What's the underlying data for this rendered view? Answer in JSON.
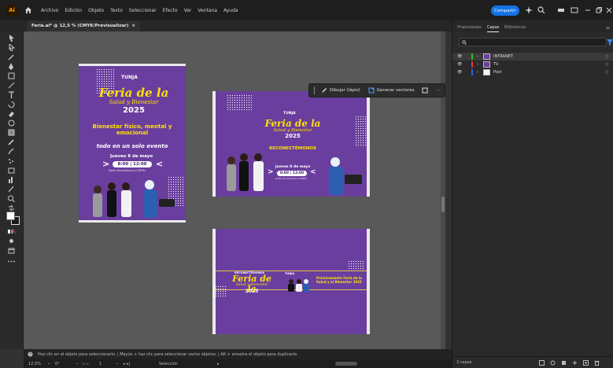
{
  "menu": {
    "app_badge": "Ai",
    "items": [
      "Archivo",
      "Edición",
      "Objeto",
      "Texto",
      "Seleccionar",
      "Efecto",
      "Ver",
      "Ventana",
      "Ayuda"
    ],
    "share_label": "Compartir"
  },
  "document_tab": {
    "title": "Feria.ai* @ 12,5 % (CMYK/Previsualizar)",
    "close": "×"
  },
  "context_bar": {
    "draw_label": "Dibujar (lápiz)",
    "vectorize_label": "Generar vectores",
    "more": "···"
  },
  "panel": {
    "tabs": [
      "Propiedades",
      "Capas",
      "Bibliotecas"
    ],
    "active_tab": "Capas",
    "layers": [
      {
        "name": "INTRANET",
        "color": "#2dbe2d",
        "selected": true
      },
      {
        "name": "TV",
        "color": "#e03a3a",
        "selected": false
      },
      {
        "name": "Post",
        "color": "#3a5ae0",
        "selected": false
      }
    ],
    "layer_count": "3 capas"
  },
  "artboards": {
    "brand": "TUNJA",
    "title_line1": "Feria de la",
    "title_line2": "Salud y Bienestar",
    "year": "2025",
    "tagline1": "Bienestar físico, mental y emocional",
    "tagline2": "todo en un solo evento",
    "date": "Jueves 8 de mayo",
    "time": "8:00 | 12:00",
    "venue": "Salón Bicentenario (CREM)",
    "reconnect": "RECONECTÉMONOS",
    "banner_upper": "RECONECTÉMONOS",
    "banner_right": "Próximamente Feria de la Salud y el Bienestar 2025"
  },
  "status": {
    "hint": "Haz clic en el objeto para seleccionarlo. | Mayús + haz clic para seleccionar varios objetos. | Alt + arrastra el objeto para duplicarlo.",
    "zoom": "12,5%",
    "rotation": "0°",
    "artboard_num": "1",
    "mode": "Selección"
  },
  "colors": {
    "accent": "#1473e6",
    "artboard_purple": "#6a3e9e",
    "title_yellow": "#ffe100"
  }
}
